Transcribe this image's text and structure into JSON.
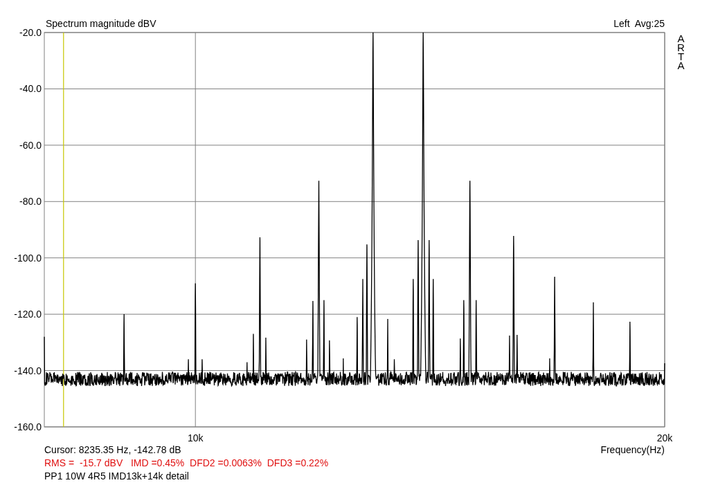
{
  "chart": {
    "title": "Spectrum magnitude dBV",
    "channel_info": "Left  Avg:25",
    "logo": "ARTA",
    "y_axis_labels": [
      "-20.0",
      "-40.0",
      "-60.0",
      "-80.0",
      "-100.0",
      "-120.0",
      "-140.0",
      "-160.0"
    ],
    "x_axis_labels": [
      "10k",
      "20k"
    ],
    "x_axis_title": "Frequency(Hz)",
    "cursor": {
      "level": 0.031
    },
    "cursor_readout": "Cursor: 8235.35 Hz, -142.78 dB",
    "measurements": "RMS =  -15.7 dBV   IMD =0.45%  DFD2 =0.0063%  DFD3 =0.22%",
    "note": "PP1 10W 4R5 IMD13k+14k detail"
  }
}
